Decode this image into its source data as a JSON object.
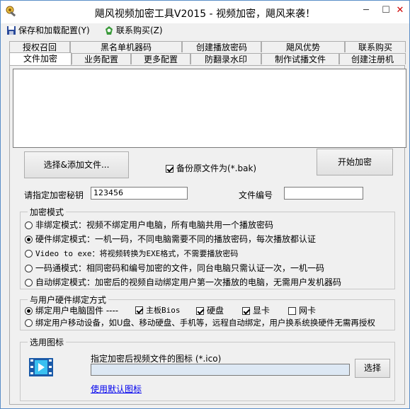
{
  "window": {
    "title": "飓风视频加密工具V2015 - 视频加密，飓风来袭！",
    "minimize": "─",
    "maximize": "☐",
    "close": "✕"
  },
  "menu": {
    "save_load": "保存和加载配置(Y)",
    "contact": "联系购买(Z)"
  },
  "tabs_row1": [
    "授权召回",
    "黑名单机器码",
    "创建播放密码",
    "飓风优势",
    "联系购买"
  ],
  "tabs_row2": [
    "文件加密",
    "业务配置",
    "更多配置",
    "防翻录水印",
    "制作试播文件",
    "创建注册机"
  ],
  "file_ops": {
    "select_add_button": "选择&添加文件...",
    "backup_label": "备份原文件为(*.bak)",
    "backup_checked": true,
    "start_button": "开始加密"
  },
  "key": {
    "label": "请指定加密秘钥",
    "value": "123456",
    "file_no_label": "文件编号",
    "file_no_value": ""
  },
  "encrypt_mode": {
    "title": "加密模式",
    "options": [
      {
        "label": "非绑定模式：视频不绑定用户电脑，所有电脑共用一个播放密码",
        "checked": false,
        "mono": false
      },
      {
        "label": "硬件绑定模式：一机一码，不同电脑需要不同的播放密码，每次播放都认证",
        "checked": true,
        "mono": false
      },
      {
        "label": "Video to exe：将视频转换为EXE格式，不需要播放密码",
        "checked": false,
        "mono": true
      },
      {
        "label": "一码通模式：相同密码和编号加密的文件，同台电脑只需认证一次，一机一码",
        "checked": false,
        "mono": false
      },
      {
        "label": "自动绑定模式：加密后的视频自动绑定用户第一次播放的电脑，无需用户发机器码",
        "checked": false,
        "mono": false
      }
    ]
  },
  "hardware": {
    "title": "与用户硬件绑定方式",
    "bind_pc_label": "绑定用户电脑固件 ----",
    "bind_pc_checked": true,
    "motherboard": "主板Bios",
    "motherboard_checked": true,
    "harddisk": "硬盘",
    "harddisk_checked": true,
    "graphics": "显卡",
    "graphics_checked": true,
    "nic": "网卡",
    "nic_checked": false,
    "bind_mobile_label": "绑定用户移动设备，如U盘、移动硬盘、手机等，远程自动绑定，用户换系统换硬件无需再授权",
    "bind_mobile_checked": false
  },
  "icon": {
    "title": "选用图标",
    "hint": "指定加密后视频文件的图标 (*.ico)",
    "path": "",
    "select_button": "选择",
    "default_link": "使用默认图标"
  }
}
